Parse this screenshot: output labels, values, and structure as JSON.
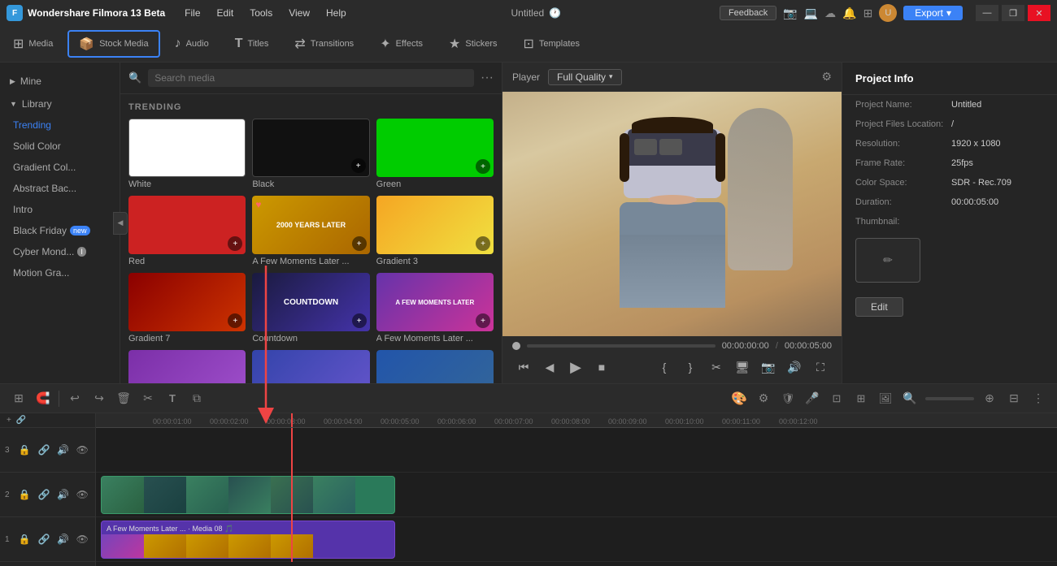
{
  "app": {
    "name": "Wondershare Filmora 13 Beta",
    "title": "Untitled",
    "logo_letter": "F"
  },
  "titlebar": {
    "menu": [
      "File",
      "Edit",
      "Tools",
      "View",
      "Help"
    ],
    "feedback_label": "Feedback",
    "export_label": "Export",
    "win_buttons": [
      "—",
      "❐",
      "✕"
    ]
  },
  "nav_tabs": [
    {
      "id": "media",
      "label": "Media",
      "icon": "⊞"
    },
    {
      "id": "stock-media",
      "label": "Stock Media",
      "icon": "📦",
      "active": true
    },
    {
      "id": "audio",
      "label": "Audio",
      "icon": "♪"
    },
    {
      "id": "titles",
      "label": "Titles",
      "icon": "T"
    },
    {
      "id": "transitions",
      "label": "Transitions",
      "icon": "⇄"
    },
    {
      "id": "effects",
      "label": "Effects",
      "icon": "✦"
    },
    {
      "id": "stickers",
      "label": "Stickers",
      "icon": "★"
    },
    {
      "id": "templates",
      "label": "Templates",
      "icon": "⊡"
    }
  ],
  "sidebar": {
    "mine_label": "Mine",
    "library_label": "Library",
    "items": [
      {
        "id": "trending",
        "label": "Trending",
        "active": true
      },
      {
        "id": "solid-color",
        "label": "Solid Color"
      },
      {
        "id": "gradient-color",
        "label": "Gradient Col..."
      },
      {
        "id": "abstract-bac",
        "label": "Abstract Bac..."
      },
      {
        "id": "intro",
        "label": "Intro"
      },
      {
        "id": "black-friday",
        "label": "Black Friday",
        "badge": "new"
      },
      {
        "id": "cyber-monday",
        "label": "Cyber Mond...",
        "badge": "i"
      },
      {
        "id": "motion-gra",
        "label": "Motion Gra..."
      }
    ]
  },
  "media_browser": {
    "search_placeholder": "Search media",
    "section_label": "TRENDING",
    "items": [
      {
        "id": "white",
        "label": "White",
        "color": "white"
      },
      {
        "id": "black",
        "label": "Black",
        "color": "black"
      },
      {
        "id": "green",
        "label": "Green",
        "color": "green"
      },
      {
        "id": "red",
        "label": "Red",
        "color": "red"
      },
      {
        "id": "moments-2000",
        "label": "A Few Moments Later ...",
        "color": "moments2000"
      },
      {
        "id": "gradient3",
        "label": "Gradient 3",
        "color": "gradient3"
      },
      {
        "id": "gradient7",
        "label": "Gradient 7",
        "color": "gradient7"
      },
      {
        "id": "countdown",
        "label": "Countdown",
        "color": "countdown"
      },
      {
        "id": "moments2",
        "label": "A Few Moments Later ...",
        "color": "moments"
      },
      {
        "id": "purple-bg",
        "label": "",
        "color": "purple"
      },
      {
        "id": "arrow-item",
        "label": "",
        "color": "arrow"
      },
      {
        "id": "adventure",
        "label": "",
        "color": "adventure"
      }
    ]
  },
  "player": {
    "label": "Player",
    "quality": "Full Quality",
    "time_current": "00:00:00:00",
    "time_total": "00:00:05:00",
    "time_separator": "/"
  },
  "project_info": {
    "title": "Project Info",
    "fields": [
      {
        "label": "Project Name:",
        "value": "Untitled"
      },
      {
        "label": "Project Files Location:",
        "value": "/"
      },
      {
        "label": "Resolution:",
        "value": "1920 x 1080"
      },
      {
        "label": "Frame Rate:",
        "value": "25fps"
      },
      {
        "label": "Color Space:",
        "value": "SDR - Rec.709"
      },
      {
        "label": "Duration:",
        "value": "00:00:05:00"
      },
      {
        "label": "Thumbnail:",
        "value": ""
      }
    ],
    "edit_label": "Edit"
  },
  "timeline": {
    "tracks": [
      {
        "num": "3",
        "type": "video"
      },
      {
        "num": "2",
        "type": "overlay"
      },
      {
        "num": "1",
        "type": "video"
      }
    ],
    "ruler_marks": [
      "00:00:01:00",
      "00:00:02:00",
      "00:00:03:00",
      "00:00:04:00",
      "00:00:05:00",
      "00:00:06:00",
      "00:00:07:00",
      "00:00:08:00",
      "00:00:09:00",
      "00:00:10:00",
      "00:00:11:00",
      "00:00:12:00"
    ]
  }
}
